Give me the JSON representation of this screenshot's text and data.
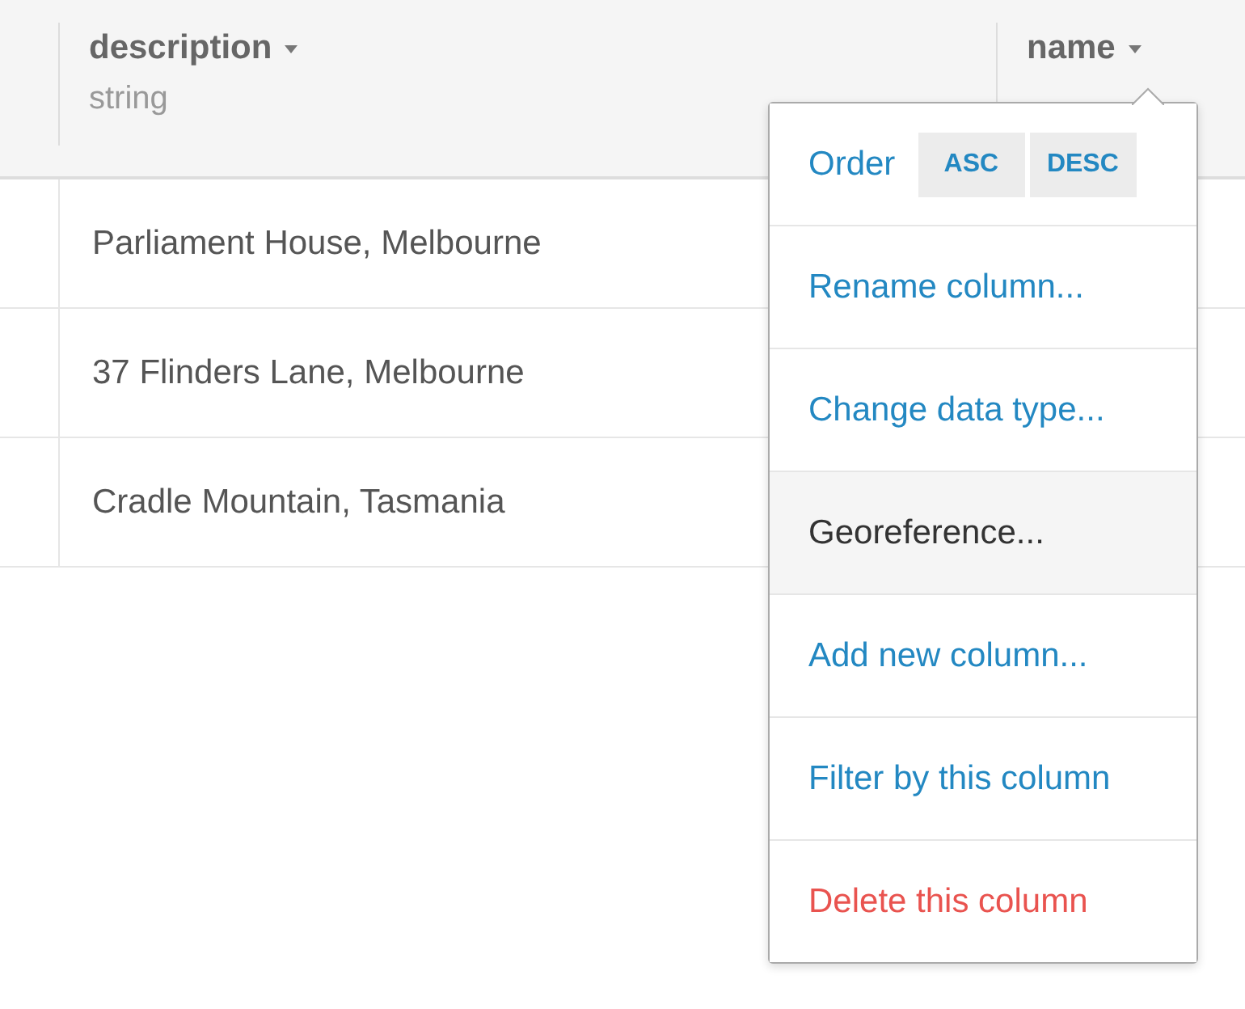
{
  "columns": [
    {
      "label": "description",
      "type": "string"
    },
    {
      "label": "name"
    }
  ],
  "rows": [
    {
      "description": "Parliament House, Melbourne"
    },
    {
      "description": "37 Flinders Lane, Melbourne"
    },
    {
      "description": "Cradle Mountain, Tasmania"
    }
  ],
  "column_menu": {
    "items": [
      {
        "kind": "sort",
        "label": "Order",
        "buttons": [
          "ASC",
          "DESC"
        ],
        "selected": false
      },
      {
        "kind": "link",
        "label": "Rename column...",
        "selected": false
      },
      {
        "kind": "link",
        "label": "Change data type...",
        "selected": false
      },
      {
        "kind": "link",
        "label": "Georeference...",
        "selected": true
      },
      {
        "kind": "link",
        "label": "Add new column...",
        "selected": false
      },
      {
        "kind": "link",
        "label": "Filter by this column",
        "selected": false
      },
      {
        "kind": "danger",
        "label": "Delete this column",
        "selected": false
      }
    ]
  }
}
